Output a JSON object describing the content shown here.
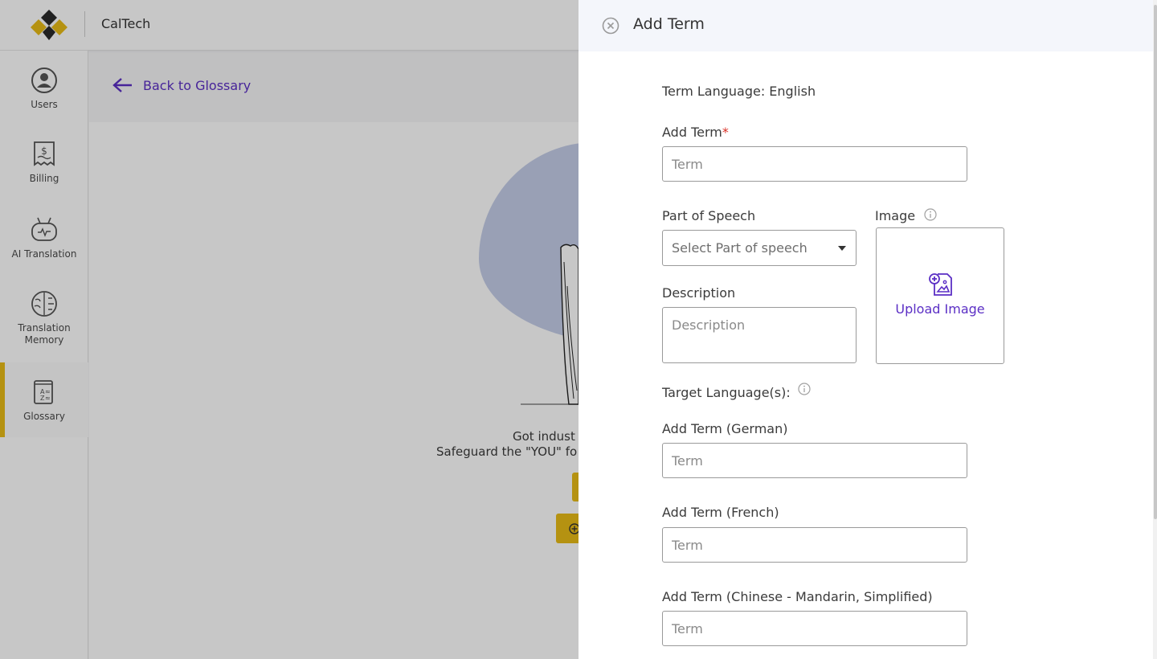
{
  "app": {
    "org_name": "CalTech"
  },
  "sidebar": {
    "items": [
      {
        "label": "Users",
        "icon": "user-icon"
      },
      {
        "label": "Billing",
        "icon": "receipt-icon"
      },
      {
        "label": "AI Translation",
        "icon": "robot-icon"
      },
      {
        "label": "Translation Memory",
        "icon": "brain-icon"
      },
      {
        "label": "Glossary",
        "icon": "glossary-book-icon",
        "active": true
      }
    ]
  },
  "main": {
    "back_link": "Back to Glossary",
    "empty_line1": "Got indust",
    "empty_line2": "Safeguard the \"YOU\" fo"
  },
  "drawer": {
    "title": "Add Term",
    "term_language": "Term Language: English",
    "add_term_label": "Add Term",
    "required_mark": "*",
    "term_placeholder": "Term",
    "part_of_speech_label": "Part of Speech",
    "part_of_speech_placeholder": "Select Part of speech",
    "image_label": "Image",
    "upload_label": "Upload Image",
    "description_label": "Description",
    "description_placeholder": "Description",
    "target_languages_label": "Target Language(s):",
    "targets": [
      {
        "label": "Add Term (German)",
        "placeholder": "Term"
      },
      {
        "label": "Add Term (French)",
        "placeholder": "Term"
      },
      {
        "label": "Add Term (Chinese - Mandarin, Simplified)",
        "placeholder": "Term"
      }
    ]
  },
  "colors": {
    "accent_purple": "#5b2fc5",
    "accent_yellow": "#e8bc16",
    "required_red": "#d93025"
  }
}
